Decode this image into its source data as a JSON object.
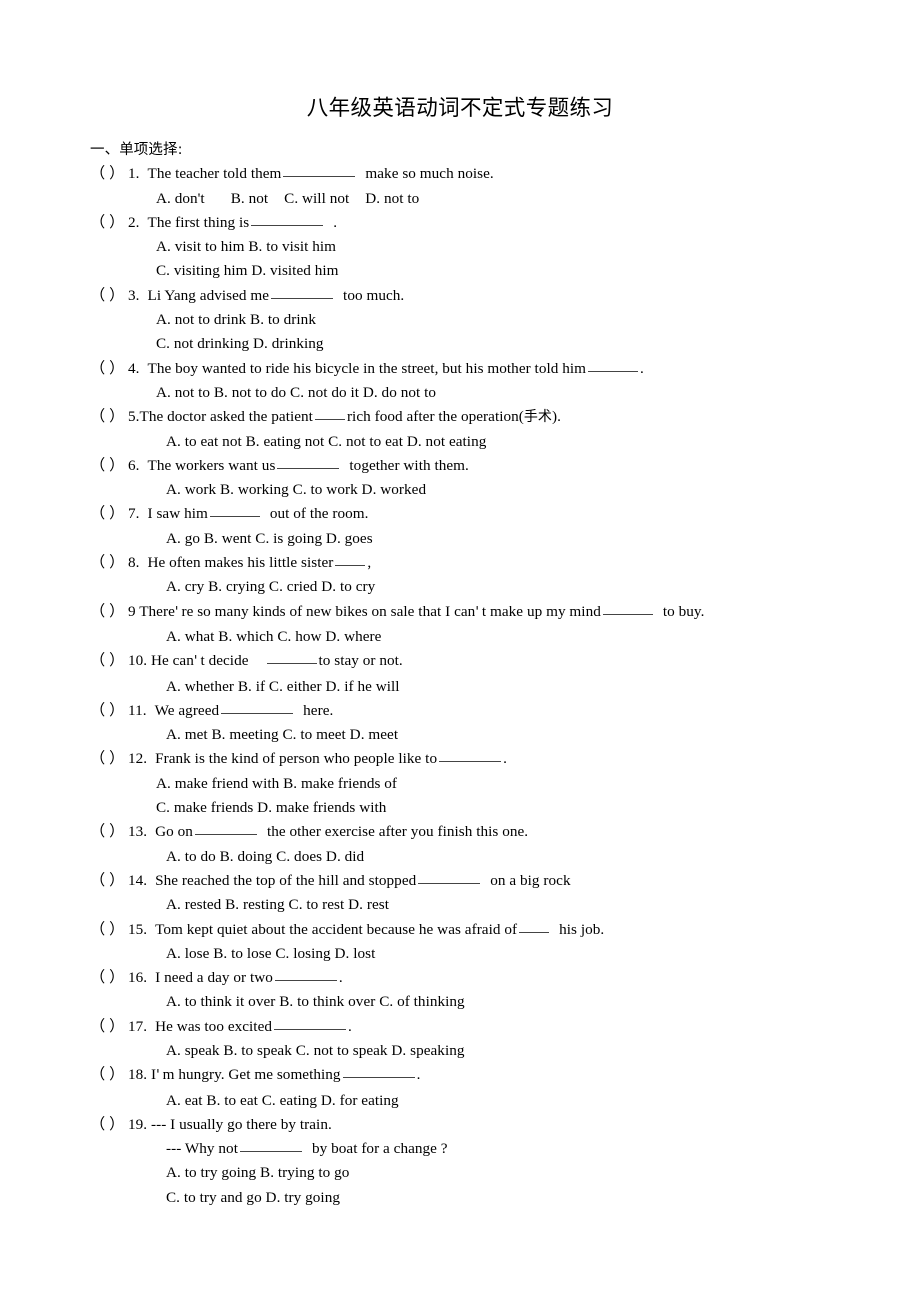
{
  "document": {
    "title": "八年级英语动词不定式专题练习",
    "section_heading": "一、单项选择:",
    "marker": "（  ）"
  },
  "questions": [
    {
      "num": "1.",
      "stem_before": "The teacher told them",
      "stem_after": "make so much noise.",
      "options_text": "A. don't      B. not     C. will not     D. not to"
    },
    {
      "num": "2.",
      "stem_before": "The first thing is",
      "stem_after": ".",
      "options_row1": "A. visit to him         B. to visit him",
      "options_row2": "C. visiting him        D. visited him"
    },
    {
      "num": "3.",
      "stem_before": "Li Yang advised me",
      "stem_after": "too much.",
      "options_row1": "A. not to drink                  B. to drink",
      "options_row2": "C. not drinking                 D. drinking"
    },
    {
      "num": "4.",
      "stem_before": "The boy wanted to ride his bicycle in the street, but his mother told him",
      "stem_after": ".",
      "options_text": "A. not to     B. not to do     C. not do it     D. do not to"
    },
    {
      "num": "5.",
      "stem_before": "The doctor asked the patient",
      "stem_after": "rich food after the operation(手术).",
      "options_text": "A. to eat not     B. eating not     C. not to eat     D. not eating"
    },
    {
      "num": "6.",
      "stem_before": "The workers want us",
      "stem_after": "together with them.",
      "options_text": "A. work     B. working     C. to work     D. worked"
    },
    {
      "num": "7.",
      "stem_before": "I saw him",
      "stem_after": "out of the room.",
      "options_text": "A. go     B. went    C. is going    D. goes"
    },
    {
      "num": "8.",
      "stem_before": "He often makes his little sister",
      "stem_after": ",",
      "options_text": "A. cry   B. crying   C. cried     D. to cry"
    },
    {
      "num": "9",
      "stem_before": "There're so many kinds of new bikes on sale that I can't make up my mind",
      "stem_after": "to buy.",
      "options_text": "A. what     B. which     C. how     D. where"
    },
    {
      "num": "10.",
      "stem_before": "He can't decide",
      "stem_after": "to stay or not.",
      "options_text": "A. whether     B. if    C. either     D. if he will"
    },
    {
      "num": "11.",
      "stem_before": "We agreed",
      "stem_after": "here.",
      "options_text": "A. met     B. meeting     C. to meet     D. meet"
    },
    {
      "num": "12.",
      "stem_before": "Frank is the kind of person who people like to",
      "stem_after": ".",
      "options_row1": "A. make friend with         B. make friends of",
      "options_row2": "C. make friends                D. make friends with"
    },
    {
      "num": "13.",
      "stem_before": "Go on",
      "stem_after": "the other exercise after you finish this one.",
      "options_text": "A. to do     B. doing     C. does     D. did"
    },
    {
      "num": "14.",
      "stem_before": "She reached the top of the hill and stopped",
      "stem_after": "on a big rock",
      "options_text": "A. rested     B. resting     C. to rest     D. rest"
    },
    {
      "num": "15.",
      "stem_before": "Tom kept quiet about the accident because he was afraid of",
      "stem_after": "his job.",
      "options_text": "A. lose        B. to lose   C. losing      D. lost"
    },
    {
      "num": "16.",
      "stem_before": "I need a day or two",
      "stem_after": ".",
      "options_text": "A. to think it over    B. to think over    C. of thinking"
    },
    {
      "num": "17.",
      "stem_before": "He was too excited",
      "stem_after": ".",
      "options_text": "A. speak     B. to speak     C. not to speak     D. speaking"
    },
    {
      "num": "18.",
      "stem_before": "I'm hungry. Get me something",
      "stem_after": ".",
      "options_text": "A. eat     B. to eat     C. eating     D. for eating"
    },
    {
      "num": "19.",
      "stem_line1": "--- I usually go there by train.",
      "stem_before2": "--- Why not",
      "stem_after2": "by boat for a change ?",
      "options_row1": "A. to try going          B. trying to go",
      "options_row2": "C. to try and go         D. try going"
    }
  ],
  "pieces": {
    "q1_opt_a": "A. don't",
    "q1_opt_b": "B. not",
    "q1_opt_c": "C. will not",
    "q1_opt_d": "D. not to",
    "q9_text_1": "9 There",
    "q9_apos": "'",
    "q9_text_2": "re so many kinds of new bikes on sale that I can",
    "q9_text_3": "t make up my mind",
    "q9_text_4": "to buy.",
    "q10_text_1": "10. He can",
    "q10_text_2": "t decide",
    "q10_text_3": "to stay or not.",
    "q18_text_1": "18. I",
    "q18_text_2": "m hungry. Get me something",
    "q18_text_3": ".",
    "q5_text_1": "5.The doctor asked the patient",
    "q5_text_2": "rich food after the operation(",
    "q5_cn": "手术",
    "q5_text_3": ").",
    "q19_dash1": "19. --- I usually go there by train.",
    "q19_dash2": "--- Why not",
    "q19_dash3": "by boat for a change ?"
  }
}
